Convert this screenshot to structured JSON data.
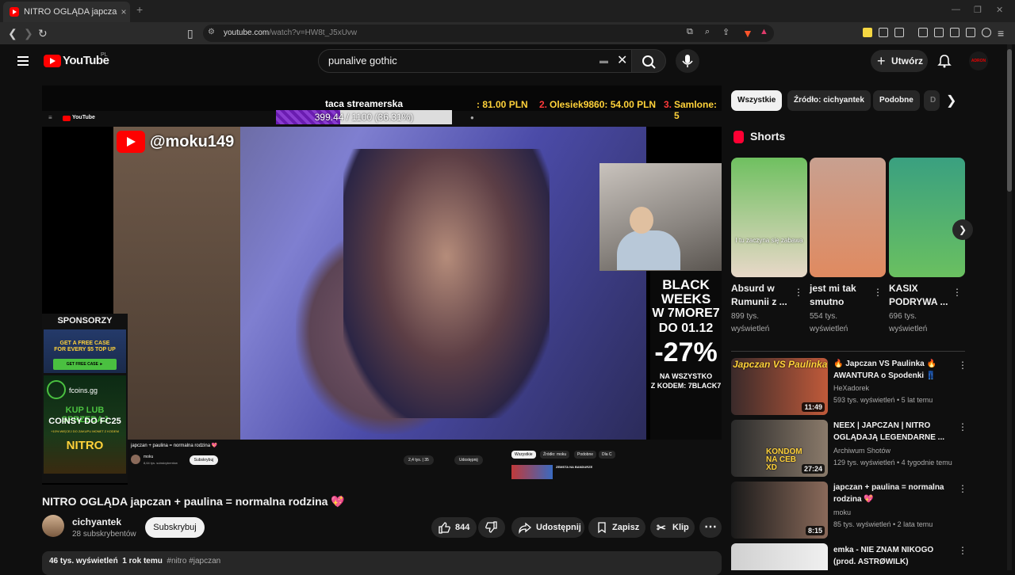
{
  "browser": {
    "tab_title": "NITRO OGLĄDA japczan + pauli",
    "tab_close": "×",
    "new_tab": "+",
    "url_host": "youtube.com",
    "url_path": "/watch?v=HW8t_J5xUvw"
  },
  "header": {
    "logo_text": "YouTube",
    "logo_region": "PL",
    "search_value": "punalive gothic",
    "create_label": "Utwórz",
    "avatar_text": "ADRON"
  },
  "video": {
    "goal_title": "taca streamerska",
    "goal_text": "399.44 / 1100 (36.31%)",
    "goal_progress": 0.3631,
    "donor1": ": 81.00 PLN",
    "donor2_rank": "2.",
    "donor2": "Olesiek9860: 54.00 PLN",
    "donor3_rank": "3.",
    "donor3": "Samlone: 5",
    "handle": "@moku149",
    "inner_logo": "YouTube",
    "sponsors_title": "SPONSORZY",
    "sponsor1_line1": "GET A FREE CASE",
    "sponsor1_line2": "FOR EVERY $5 TOP UP",
    "sponsor1_btn": "GET FREE CASE ►",
    "sponsor2_brand": "fcoins.gg",
    "sponsor2_line1": "KUP LUB SPRZEDAJ",
    "sponsor2_line2": "COINSY DO FC25",
    "sponsor2_small": "+10% WIĘCEJ DO ZAKUPU MONET Z KODEM",
    "sponsor2_code": "NITRO",
    "promo_line1": "BLACK",
    "promo_line2": "WEEKS",
    "promo_line3": "W 7MORE7",
    "promo_line4": "DO 01.12",
    "promo_line5": "-27%",
    "promo_line6": "NA WSZYSTKO",
    "promo_line7": "Z KODEM: 7BLACK7",
    "inner_title": "japczan + paulina = normalna rodzina 💖",
    "inner_channel": "moku",
    "inner_subs": "8,64 tys. subskrybentów",
    "inner_sub_btn": "Subskrybuj",
    "inner_likes": "2,4 tys.",
    "inner_dislikes": "35",
    "inner_share": "Udostępnij",
    "inner_chips": [
      "Wszystkie",
      "Źródło: moku",
      "Podobne",
      "Dla C"
    ],
    "inner_next": "ZEMSTA NA BANDURZE"
  },
  "meta": {
    "title": "NITRO OGLĄDA japczan + paulina = normalna rodzina 💖",
    "channel": "cichyantek",
    "subs": "28 subskrybentów",
    "subscribe": "Subskrybuj",
    "likes": "844",
    "share": "Udostępnij",
    "save": "Zapisz",
    "clip": "Klip",
    "views": "46 tys. wyświetleń",
    "age": "1 rok temu",
    "tags": "#nitro #japczan"
  },
  "sidebar": {
    "chips": [
      "Wszystkie",
      "Źródło: cichyantek",
      "Podobne",
      "D"
    ],
    "shorts_title": "Shorts",
    "shorts": [
      {
        "title1": "Absurd w",
        "title2": "Rumunii z ...",
        "views1": "899 tys.",
        "views2": "wyświetleń",
        "overlay": "I tu zaczyna się zabawa",
        "color1": "#6fc060",
        "color2": "#e8d8c8"
      },
      {
        "title1": "jest mi tak",
        "title2": "smutno",
        "views1": "554 tys.",
        "views2": "wyświetleń",
        "overlay": "",
        "color1": "#c8a090",
        "color2": "#e08a60"
      },
      {
        "title1": "KASIX",
        "title2": "PODRYWA ...",
        "views1": "696 tys.",
        "views2": "wyświetleń",
        "overlay": "",
        "color1": "#3aa080",
        "color2": "#6ac060"
      }
    ],
    "recs": [
      {
        "title": "🔥 Japczan VS Paulinka 🔥 AWANTURA o Spodenki 👖",
        "channel": "HeXadorek",
        "meta": "593 tys. wyświetleń • 5 lat temu",
        "duration": "11:49",
        "overlay": "Japczan VS Paulinka",
        "c1": "#3a2a2a",
        "c2": "#c05a3a"
      },
      {
        "title": "NEEX | JAPCZAN | NITRO OGLĄDAJĄ LEGENDARNE ...",
        "channel": "Archiwum Shotów",
        "meta": "129 tys. wyświetleń • 4 tygodnie temu",
        "duration": "27:24",
        "overlay": "KONDOM NA CEB XD",
        "c1": "#2a2a2a",
        "c2": "#8a7a6a"
      },
      {
        "title": "japczan + paulina = normalna rodzina 💖",
        "channel": "moku",
        "meta": "85 tys. wyświetleń • 2 lata temu",
        "duration": "8:15",
        "overlay": "",
        "c1": "#1a1a1a",
        "c2": "#8a6a5a"
      },
      {
        "title": "emka - NIE ZNAM NIKOGO (prod. ASTRØWILK)",
        "channel": "",
        "meta": "",
        "duration": "",
        "overlay": "",
        "c1": "#d0d0d0",
        "c2": "#f0f0f0"
      }
    ]
  }
}
